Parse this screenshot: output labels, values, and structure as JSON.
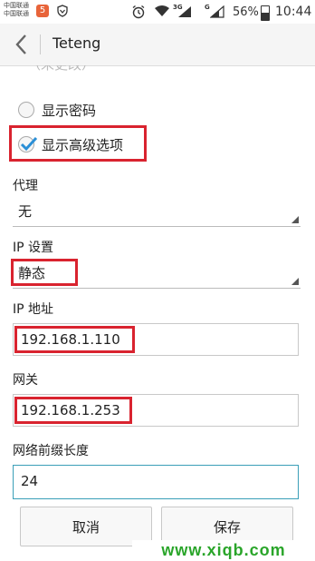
{
  "status_bar": {
    "carrier_line1": "中国联通",
    "carrier_line2": "中国联通",
    "network_3g": "3G",
    "network_g": "G",
    "battery_percent": "56%",
    "battery_level": 0.56,
    "time": "10:44",
    "icons": [
      "app-notification-icon",
      "shield-icon",
      "alarm-icon",
      "wifi-icon",
      "signal-icon",
      "signal-icon",
      "battery-icon"
    ]
  },
  "titlebar": {
    "title": "Teteng"
  },
  "form": {
    "cut_off_text": "（未更改）",
    "show_password_label": "显示密码",
    "show_advanced_label": "显示高级选项",
    "show_advanced_checked": true,
    "proxy_label": "代理",
    "proxy_value": "无",
    "ip_settings_label": "IP 设置",
    "ip_settings_value": "静态",
    "ip_address_label": "IP 地址",
    "ip_address_value": "192.168.1.110",
    "gateway_label": "网关",
    "gateway_value": "192.168.1.253",
    "prefix_label": "网络前缀长度",
    "prefix_value": "24"
  },
  "buttons": {
    "cancel": "取消",
    "save": "保存"
  },
  "watermark": "www.xiqb.com",
  "colors": {
    "highlight_box": "#d9232f",
    "focus_border": "#3a9fb8",
    "check_mark": "#2b8fd6",
    "watermark": "#2aa52a"
  }
}
